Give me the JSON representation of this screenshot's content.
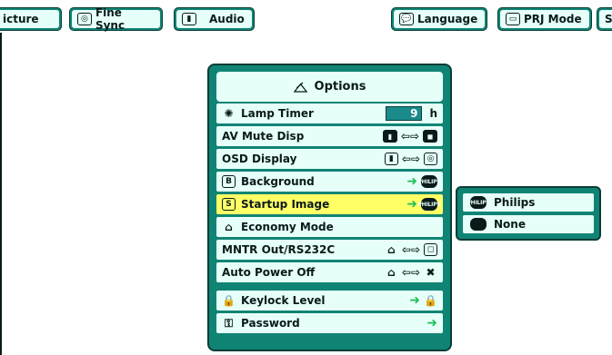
{
  "topbar": {
    "tabs": [
      {
        "label": "icture",
        "icon": "picture-icon"
      },
      {
        "label": "Fine Sync",
        "icon": "target-icon"
      },
      {
        "label": "Audio",
        "icon": "speaker-icon"
      },
      {
        "label": "Language",
        "icon": "speech-bubble-icon"
      },
      {
        "label": "PRJ Mode",
        "icon": "monitor-icon"
      },
      {
        "label": "S",
        "icon": "more-icon"
      }
    ]
  },
  "options": {
    "title": "Options",
    "rows": [
      {
        "label": "Lamp Timer",
        "value": "9",
        "unit": "h"
      },
      {
        "label": "AV Mute Disp"
      },
      {
        "label": "OSD Display"
      },
      {
        "label": "Background",
        "philips": "PHILIPS"
      },
      {
        "label": "Startup Image",
        "philips": "PHILIPS"
      },
      {
        "label": "Economy Mode"
      },
      {
        "label": "MNTR Out/RS232C"
      },
      {
        "label": "Auto Power Off"
      },
      {
        "label": "Keylock Level"
      },
      {
        "label": "Password"
      }
    ]
  },
  "submenu": {
    "items": [
      {
        "label": "Philips",
        "badge": "PHILIPS"
      },
      {
        "label": "None"
      }
    ]
  },
  "colors": {
    "panel": "#108474",
    "row_bg": "#e6fff9",
    "selected": "#ffff66",
    "accent_arrow": "#20c05a"
  }
}
